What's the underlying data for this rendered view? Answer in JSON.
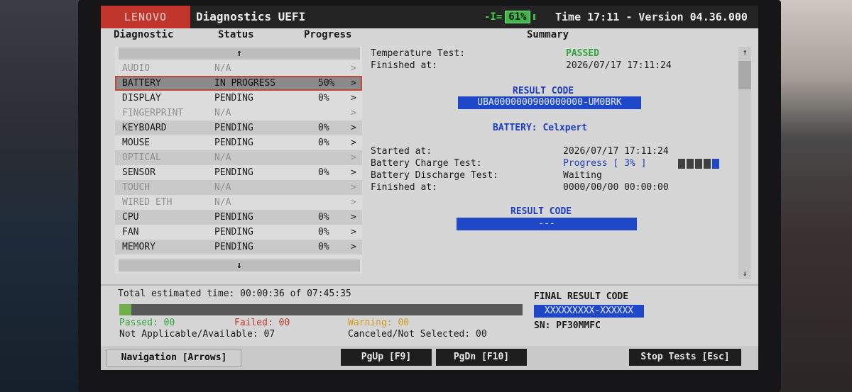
{
  "header": {
    "logo": "LENOVO",
    "title": "Diagnostics UEFI",
    "battery_plug": "-I=",
    "battery_pct": "61%",
    "time_version": "Time 17:11 - Version 04.36.000"
  },
  "columns": {
    "diagnostic": "Diagnostic",
    "status": "Status",
    "progress": "Progress",
    "summary": "Summary"
  },
  "list": {
    "scroll_up": "↑",
    "scroll_down": "↓",
    "rows": [
      {
        "name": "AUDIO",
        "status": "N/A",
        "progress": "",
        "arrow": ">"
      },
      {
        "name": "BATTERY",
        "status": "IN PROGRESS",
        "progress": "50%",
        "arrow": ">"
      },
      {
        "name": "DISPLAY",
        "status": "PENDING",
        "progress": "0%",
        "arrow": ">"
      },
      {
        "name": "FINGERPRINT",
        "status": "N/A",
        "progress": "",
        "arrow": ">"
      },
      {
        "name": "KEYBOARD",
        "status": "PENDING",
        "progress": "0%",
        "arrow": ">"
      },
      {
        "name": "MOUSE",
        "status": "PENDING",
        "progress": "0%",
        "arrow": ">"
      },
      {
        "name": "OPTICAL",
        "status": "N/A",
        "progress": "",
        "arrow": ">"
      },
      {
        "name": "SENSOR",
        "status": "PENDING",
        "progress": "0%",
        "arrow": ">"
      },
      {
        "name": "TOUCH",
        "status": "N/A",
        "progress": "",
        "arrow": ">"
      },
      {
        "name": "WIRED ETH",
        "status": "N/A",
        "progress": "",
        "arrow": ">"
      },
      {
        "name": "CPU",
        "status": "PENDING",
        "progress": "0%",
        "arrow": ">"
      },
      {
        "name": "FAN",
        "status": "PENDING",
        "progress": "0%",
        "arrow": ">"
      },
      {
        "name": "MEMORY",
        "status": "PENDING",
        "progress": "0%",
        "arrow": ">"
      }
    ]
  },
  "summary": {
    "temp_label": "Temperature Test:",
    "temp_value": "PASSED",
    "finished1_label": "Finished at:",
    "finished1_value": "2026/07/17 17:11:24",
    "result_code_label1": "RESULT CODE",
    "result_code_value1": "UBA0000000900000000-UM0BRK",
    "battery_line": "BATTERY: Celxpert",
    "started_label": "Started at:",
    "started_value": "2026/07/17 17:11:24",
    "charge_label": "Battery Charge Test:",
    "charge_value": "Progress [ 3% ]",
    "discharge_label": "Battery Discharge Test:",
    "discharge_value": "Waiting",
    "finished2_label": "Finished at:",
    "finished2_value": "0000/00/00 00:00:00",
    "result_code_label2": "RESULT CODE",
    "result_code_value2": "---",
    "scroll_up": "↑",
    "scroll_down": "↓",
    "charge_progress_fraction": 0.2
  },
  "totals": {
    "estimated": "Total estimated time: 00:00:36 of 07:45:35",
    "progress_fraction": 0.03,
    "passed": "Passed: 00",
    "failed": "Failed: 00",
    "warning": "Warning: 00",
    "not_applicable": "Not Applicable/Available: 07",
    "canceled": "Canceled/Not Selected: 00",
    "final_label": "FINAL RESULT CODE",
    "final_value": "XXXXXXXXX-XXXXXX",
    "sn": "SN: PF30MMFC"
  },
  "footer": {
    "navigation": "Navigation [Arrows]",
    "pgup": "PgUp [F9]",
    "pgdn": "PgDn [F10]",
    "stop": "Stop Tests [Esc]"
  },
  "colors": {
    "accent_red": "#c0362c",
    "code_blue": "#1f48c9",
    "passed_green": "#2fa53a",
    "battery_green": "#3fb54a"
  }
}
